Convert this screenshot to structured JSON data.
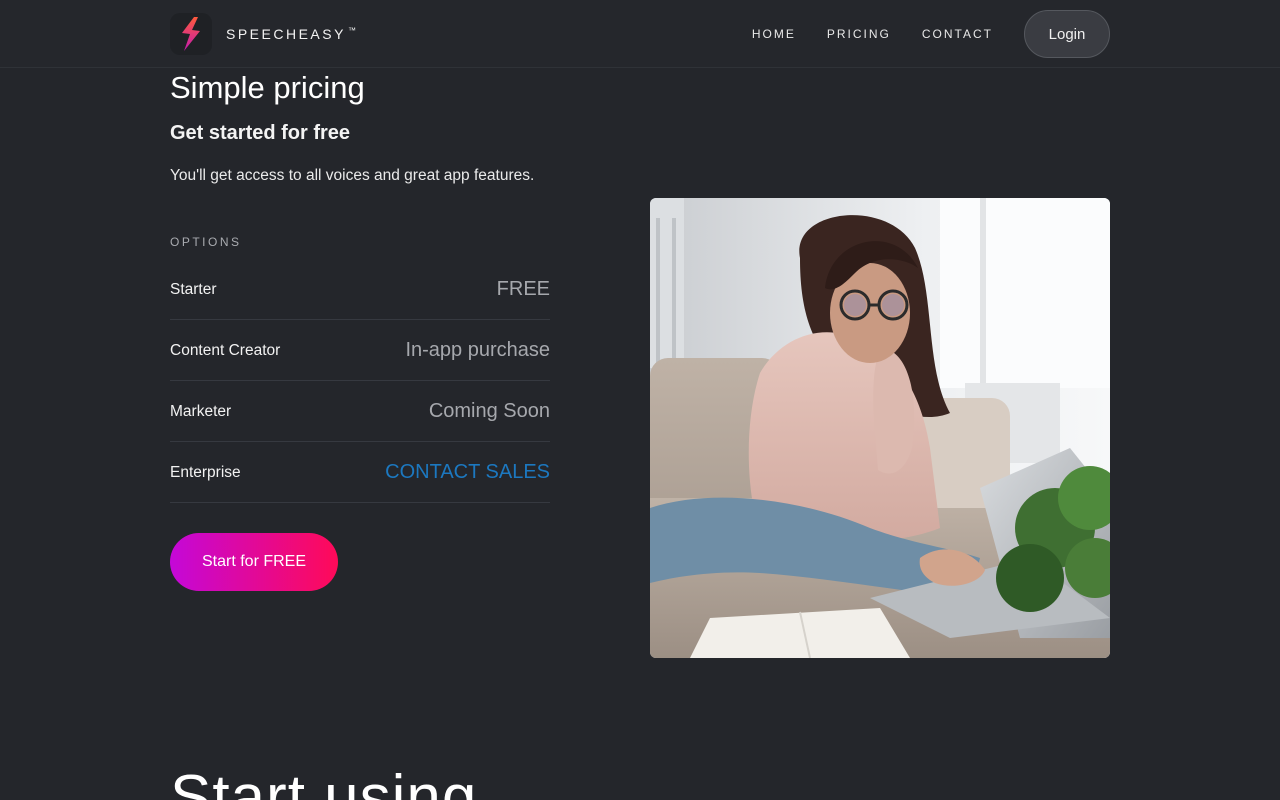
{
  "brand": {
    "name": "SPEECHEASY",
    "trademark": "™",
    "gradient_from": "#ff5a3c",
    "gradient_to": "#c41ab0"
  },
  "nav": {
    "items": [
      {
        "label": "HOME"
      },
      {
        "label": "PRICING"
      },
      {
        "label": "CONTACT"
      }
    ],
    "login_label": "Login"
  },
  "pricing": {
    "title": "Simple pricing",
    "subtitle": "Get started for free",
    "description": "You'll get access to all voices and great app features.",
    "options_label": "OPTIONS",
    "options": [
      {
        "name": "Starter",
        "value": "FREE",
        "is_link": false
      },
      {
        "name": "Content Creator",
        "value": "In-app purchase",
        "is_link": false
      },
      {
        "name": "Marketer",
        "value": "Coming Soon",
        "is_link": false
      },
      {
        "name": "Enterprise",
        "value": "CONTACT SALES",
        "is_link": true
      }
    ],
    "cta_label": "Start for FREE"
  },
  "next_section": {
    "heading": "Start using"
  },
  "colors": {
    "background": "#24262b",
    "link": "#1c78c0",
    "cta_from": "#c408d8",
    "cta_to": "#ff0a58"
  }
}
